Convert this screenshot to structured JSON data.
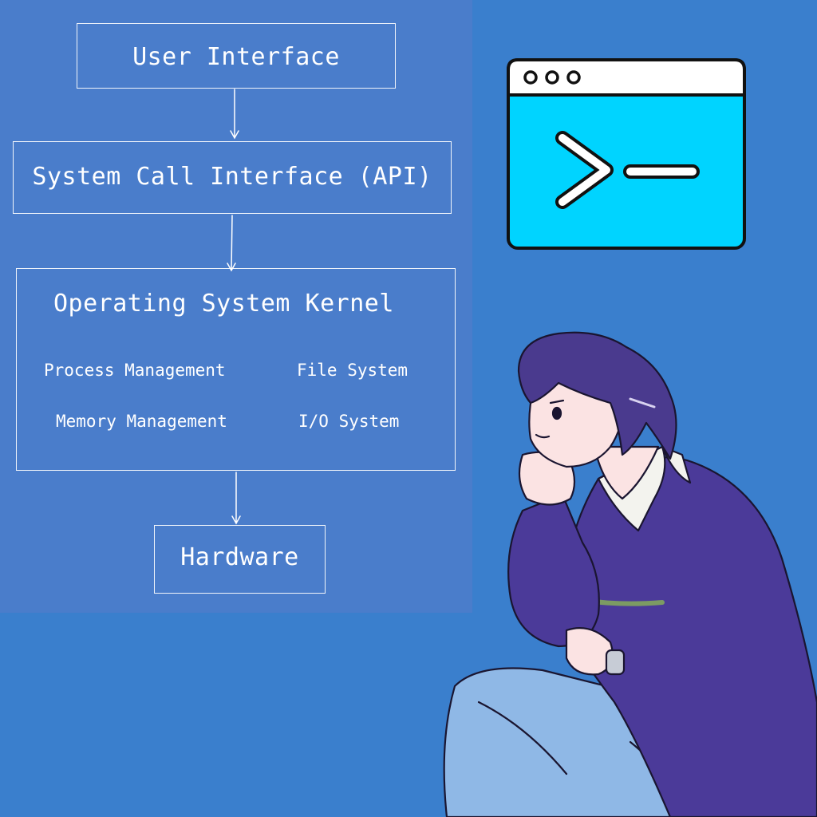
{
  "diagram": {
    "user_interface": "User Interface",
    "system_call_interface": "System Call Interface (API)",
    "kernel": {
      "title": "Operating System Kernel",
      "components": [
        "Process Management",
        "File System",
        "Memory Management",
        "I/O System"
      ]
    },
    "hardware": "Hardware"
  },
  "colors": {
    "background": "#3a7fcd",
    "diagram_panel": "#4a7dcb",
    "terminal_screen": "#00d4ff",
    "sweater": "#4b3a99",
    "jeans": "#8fb8e6"
  },
  "icons": [
    "terminal-window-icon",
    "command-prompt-icon"
  ]
}
